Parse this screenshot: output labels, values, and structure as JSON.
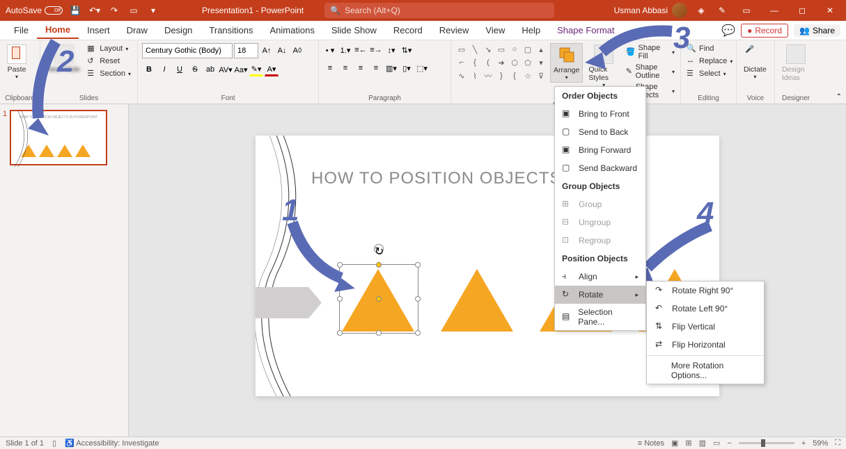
{
  "titlebar": {
    "autosave_label": "AutoSave",
    "autosave_state": "Off",
    "doc_title": "Presentation1 - PowerPoint",
    "search_placeholder": "Search (Alt+Q)",
    "user_name": "Usman Abbasi"
  },
  "tabs": {
    "file": "File",
    "home": "Home",
    "insert": "Insert",
    "draw": "Draw",
    "design": "Design",
    "transitions": "Transitions",
    "animations": "Animations",
    "slideshow": "Slide Show",
    "record": "Record",
    "review": "Review",
    "view": "View",
    "help": "Help",
    "shape_format": "Shape Format",
    "record_btn": "Record",
    "share_btn": "Share"
  },
  "ribbon": {
    "clipboard": {
      "paste": "Paste",
      "label": "Clipboard"
    },
    "slides": {
      "new_slide": "New Slide",
      "layout": "Layout",
      "reset": "Reset",
      "section": "Section",
      "label": "Slides"
    },
    "font": {
      "family": "Century Gothic (Body)",
      "size": "18",
      "label": "Font"
    },
    "paragraph": {
      "label": "Paragraph"
    },
    "drawing": {
      "arrange": "Arrange",
      "quick_styles": "Quick Styles",
      "shape_fill": "Shape Fill",
      "shape_outline": "Shape Outline",
      "shape_effects": "Shape Effects"
    },
    "editing": {
      "find": "Find",
      "replace": "Replace",
      "select": "Select",
      "label": "Editing"
    },
    "voice": {
      "dictate": "Dictate",
      "label": "Voice"
    },
    "designer": {
      "design_ideas": "Design Ideas",
      "label": "Designer"
    }
  },
  "arrange_menu": {
    "order_header": "Order Objects",
    "bring_front": "Bring to Front",
    "send_back": "Send to Back",
    "bring_forward": "Bring Forward",
    "send_backward": "Send Backward",
    "group_header": "Group Objects",
    "group": "Group",
    "ungroup": "Ungroup",
    "regroup": "Regroup",
    "position_header": "Position Objects",
    "align": "Align",
    "rotate": "Rotate",
    "selection_pane": "Selection Pane..."
  },
  "rotate_menu": {
    "right90": "Rotate Right 90°",
    "left90": "Rotate Left 90°",
    "flip_v": "Flip Vertical",
    "flip_h": "Flip Horizontal",
    "more": "More Rotation Options..."
  },
  "slide": {
    "title": "HOW TO POSITION OBJECTS  IN              INT",
    "thumb_num": "1"
  },
  "annotations": {
    "n1": "1",
    "n2": "2",
    "n3": "3",
    "n4": "4"
  },
  "statusbar": {
    "slide_info": "Slide 1 of 1",
    "accessibility": "Accessibility: Investigate",
    "notes": "Notes",
    "zoom": "59%"
  }
}
